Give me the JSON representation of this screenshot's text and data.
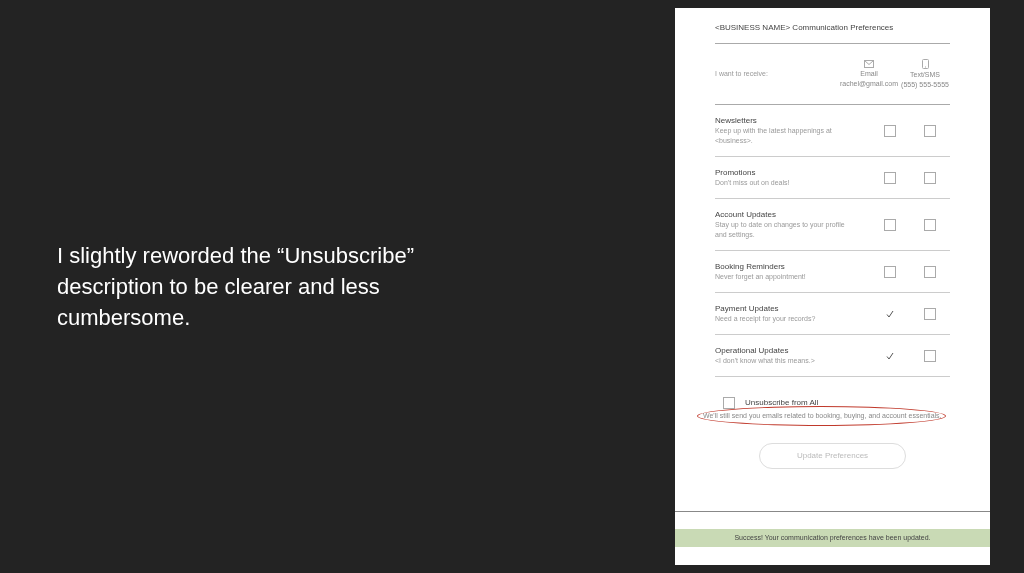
{
  "slide_text": "I slightly reworded the “Unsubscribe” description to be clearer and less cumbersome.",
  "form": {
    "title": "<BUSINESS NAME> Communication Preferences",
    "receive_label": "I want to receive:",
    "channels": [
      {
        "kind": "email",
        "label": "Email",
        "detail": "rachel@gmail.com"
      },
      {
        "kind": "sms",
        "label": "Text/SMS",
        "detail": "(555) 555-5555"
      }
    ],
    "rows": [
      {
        "title": "Newsletters",
        "description": "Keep up with the latest happenings at <business>.",
        "email": false,
        "sms": false
      },
      {
        "title": "Promotions",
        "description": "Don't miss out on deals!",
        "email": false,
        "sms": false
      },
      {
        "title": "Account Updates",
        "description": "Stay up to date on changes to your profile and settings.",
        "email": false,
        "sms": false
      },
      {
        "title": "Booking Reminders",
        "description": "Never forget an appointment!",
        "email": false,
        "sms": false
      },
      {
        "title": "Payment Updates",
        "description": "Need a receipt for your records?",
        "email": true,
        "sms": false
      },
      {
        "title": "Operational Updates",
        "description": "<I don't know what this means.>",
        "email": true,
        "sms": false
      }
    ],
    "unsubscribe": {
      "label": "Unsubscribe from All",
      "checked": false,
      "note": "We'll still send you emails related to booking, buying, and account essentials.",
      "highlighted": true
    },
    "button": "Update Preferences",
    "success_message": "Success! Your communication preferences have been updated."
  }
}
